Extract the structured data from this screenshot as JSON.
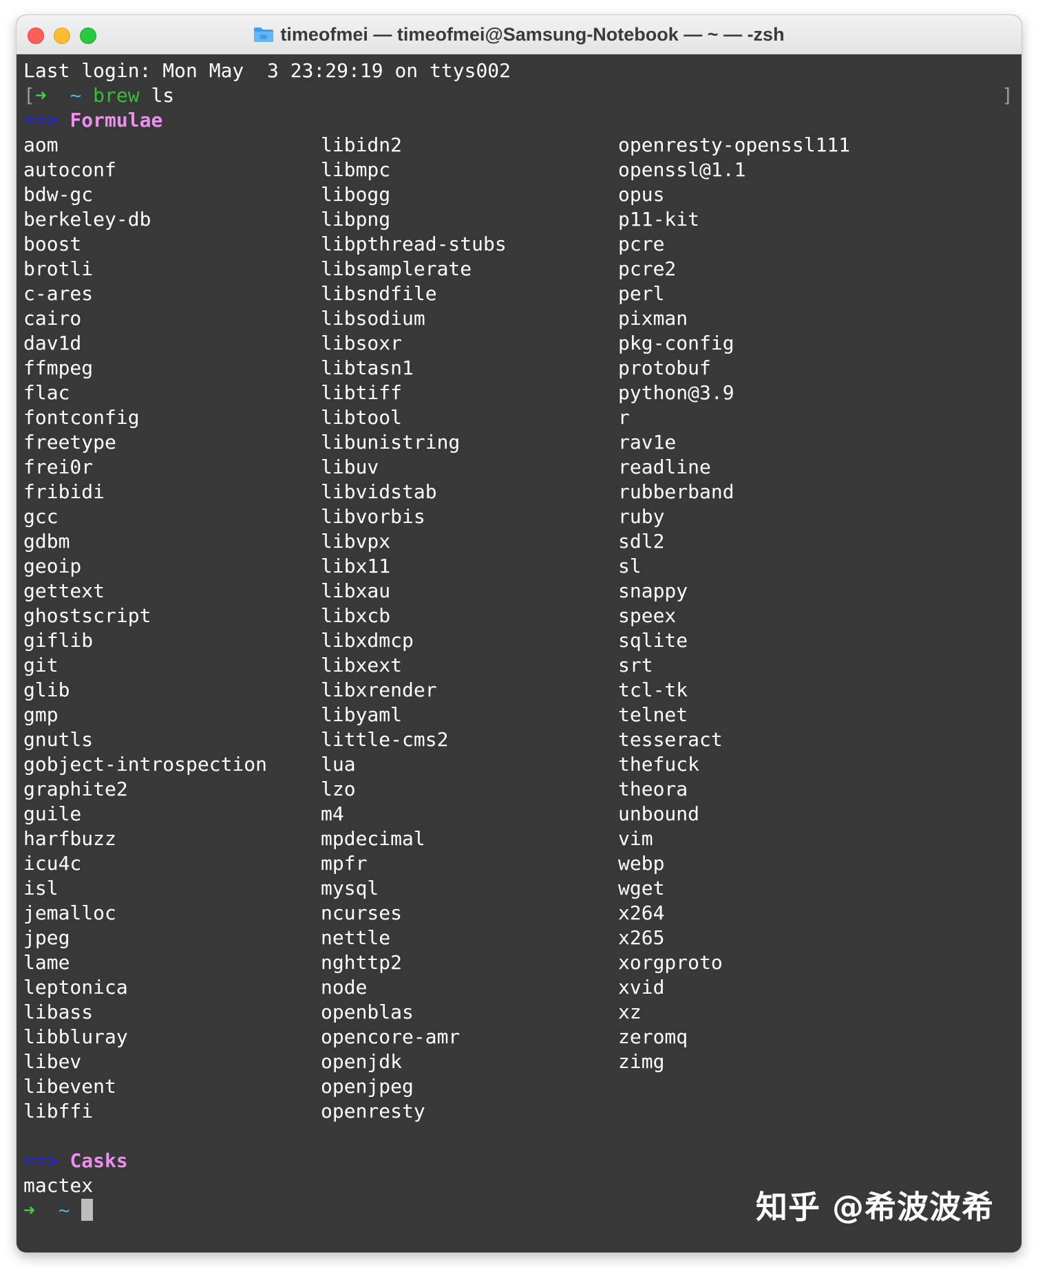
{
  "window": {
    "title": "timeofmei — timeofmei@Samsung-Notebook — ~ — -zsh",
    "folder_icon": "folder-icon",
    "accent_colors": {
      "red": "#ff5f57",
      "yellow": "#febc2e",
      "green": "#28c840"
    }
  },
  "terminal": {
    "last_login": "Last login: Mon May  3 23:29:19 on ttys002",
    "prompt_bracket_left": "[",
    "prompt_bracket_right": "]",
    "prompt_arrow": "➜",
    "prompt_dir": "~",
    "command_name": "brew",
    "command_args": " ls",
    "section_arrow": "==>",
    "formulae_header": "Formulae",
    "formulae_columns": [
      [
        "aom",
        "autoconf",
        "bdw-gc",
        "berkeley-db",
        "boost",
        "brotli",
        "c-ares",
        "cairo",
        "dav1d",
        "ffmpeg",
        "flac",
        "fontconfig",
        "freetype",
        "frei0r",
        "fribidi",
        "gcc",
        "gdbm",
        "geoip",
        "gettext",
        "ghostscript",
        "giflib",
        "git",
        "glib",
        "gmp",
        "gnutls",
        "gobject-introspection",
        "graphite2",
        "guile",
        "harfbuzz",
        "icu4c",
        "isl",
        "jemalloc",
        "jpeg",
        "lame",
        "leptonica",
        "libass",
        "libbluray",
        "libev",
        "libevent",
        "libffi"
      ],
      [
        "libidn2",
        "libmpc",
        "libogg",
        "libpng",
        "libpthread-stubs",
        "libsamplerate",
        "libsndfile",
        "libsodium",
        "libsoxr",
        "libtasn1",
        "libtiff",
        "libtool",
        "libunistring",
        "libuv",
        "libvidstab",
        "libvorbis",
        "libvpx",
        "libx11",
        "libxau",
        "libxcb",
        "libxdmcp",
        "libxext",
        "libxrender",
        "libyaml",
        "little-cms2",
        "lua",
        "lzo",
        "m4",
        "mpdecimal",
        "mpfr",
        "mysql",
        "ncurses",
        "nettle",
        "nghttp2",
        "node",
        "openblas",
        "opencore-amr",
        "openjdk",
        "openjpeg",
        "openresty"
      ],
      [
        "openresty-openssl111",
        "openssl@1.1",
        "opus",
        "p11-kit",
        "pcre",
        "pcre2",
        "perl",
        "pixman",
        "pkg-config",
        "protobuf",
        "python@3.9",
        "r",
        "rav1e",
        "readline",
        "rubberband",
        "ruby",
        "sdl2",
        "sl",
        "snappy",
        "speex",
        "sqlite",
        "srt",
        "tcl-tk",
        "telnet",
        "tesseract",
        "thefuck",
        "theora",
        "unbound",
        "vim",
        "webp",
        "wget",
        "x264",
        "x265",
        "xorgproto",
        "xvid",
        "xz",
        "zeromq",
        "zimg"
      ]
    ],
    "casks_header": "Casks",
    "casks": [
      "mactex"
    ]
  },
  "watermark": "知乎 @希波波希"
}
